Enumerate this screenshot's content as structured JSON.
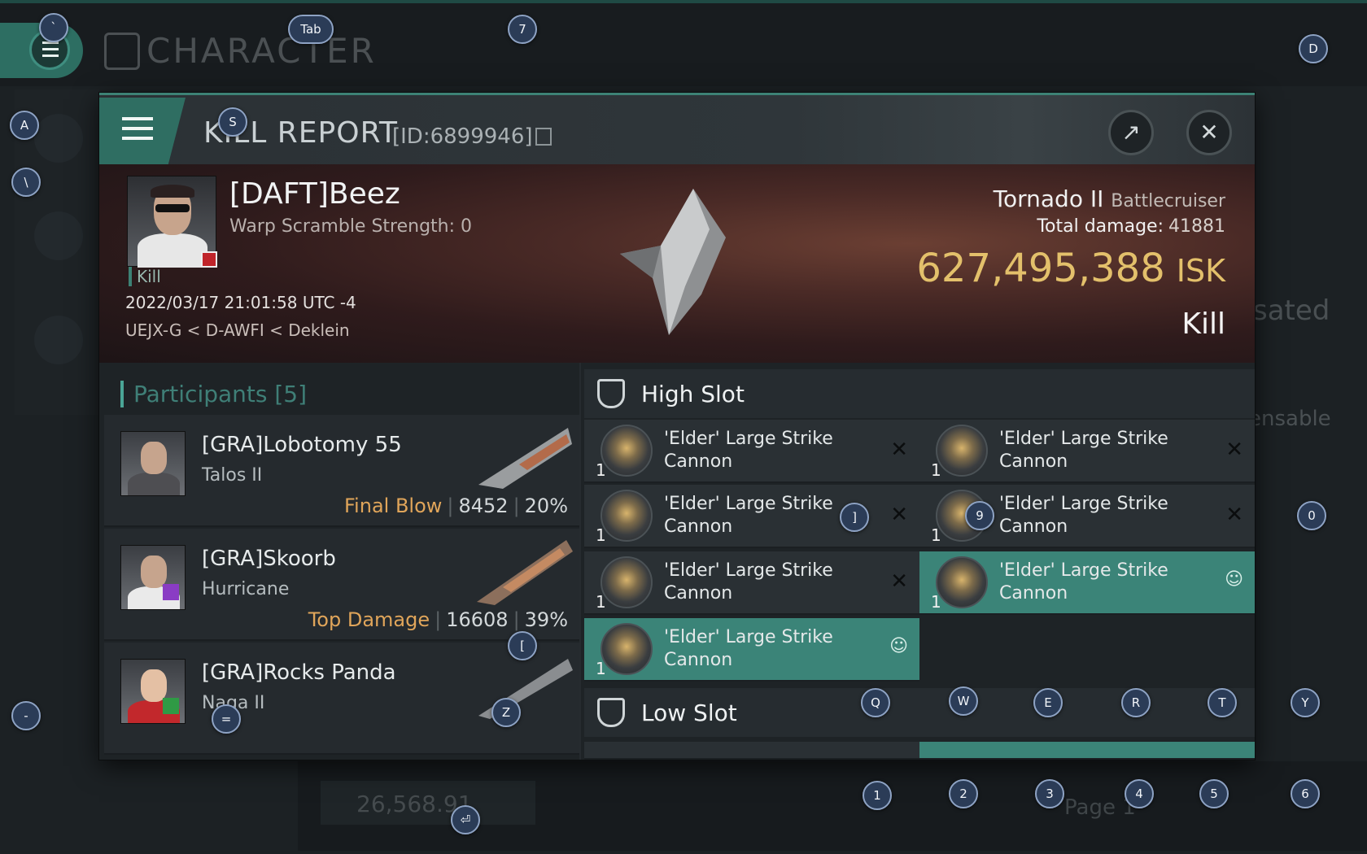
{
  "background": {
    "app_title": "CHARACTER",
    "right_text_1": "sated",
    "right_text_2": "ensable",
    "bottom_amount": "26,568.91",
    "page_label": "Page 1"
  },
  "window": {
    "title": "KILL REPORT",
    "id_label": "[ID:6899946]"
  },
  "victim": {
    "name": "[DAFT]Beez",
    "scramble": "Warp Scramble Strength: 0",
    "tag": "Kill",
    "timestamp": "2022/03/17 21:01:58 UTC -4",
    "location": "UEJX-G < D-AWFI < Deklein",
    "ship": "Tornado II",
    "ship_class": "Battlecruiser",
    "total_damage_label": "Total damage:",
    "total_damage": "41881",
    "isk_value": "627,495,388",
    "isk_unit": "ISK",
    "result": "Kill"
  },
  "participants": {
    "header": "Participants [5]",
    "rows": [
      {
        "name": "[GRA]Lobotomy 55",
        "ship": "Talos II",
        "tag": "Final Blow",
        "damage": "8452",
        "percent": "20%"
      },
      {
        "name": "[GRA]Skoorb",
        "ship": "Hurricane",
        "tag": "Top Damage",
        "damage": "16608",
        "percent": "39%"
      },
      {
        "name": "[GRA]Rocks Panda",
        "ship": "Naga II",
        "tag": "",
        "damage": "",
        "percent": ""
      }
    ]
  },
  "slots": {
    "high_label": "High Slot",
    "low_label": "Low Slot",
    "modules": [
      {
        "name": "'Elder' Large Strike Cannon",
        "qty": "1",
        "state": "destroyed"
      },
      {
        "name": "'Elder' Large Strike Cannon",
        "qty": "1",
        "state": "destroyed"
      },
      {
        "name": "'Elder' Large Strike Cannon",
        "qty": "1",
        "state": "destroyed"
      },
      {
        "name": "'Elder' Large Strike Cannon",
        "qty": "1",
        "state": "destroyed"
      },
      {
        "name": "'Elder' Large Strike Cannon",
        "qty": "1",
        "state": "destroyed"
      },
      {
        "name": "'Elder' Large Strike Cannon",
        "qty": "1",
        "state": "dropped"
      },
      {
        "name": "'Elder' Large Strike Cannon",
        "qty": "1",
        "state": "dropped"
      }
    ]
  },
  "kbd": [
    "`",
    "Tab",
    "7",
    "D",
    "A",
    "S",
    "\\",
    "-",
    "=",
    "Z",
    "[",
    "]",
    "9",
    "0",
    "Q",
    "W",
    "E",
    "R",
    "T",
    "Y",
    "1",
    "2",
    "3",
    "4",
    "5",
    "6",
    "⏎"
  ]
}
